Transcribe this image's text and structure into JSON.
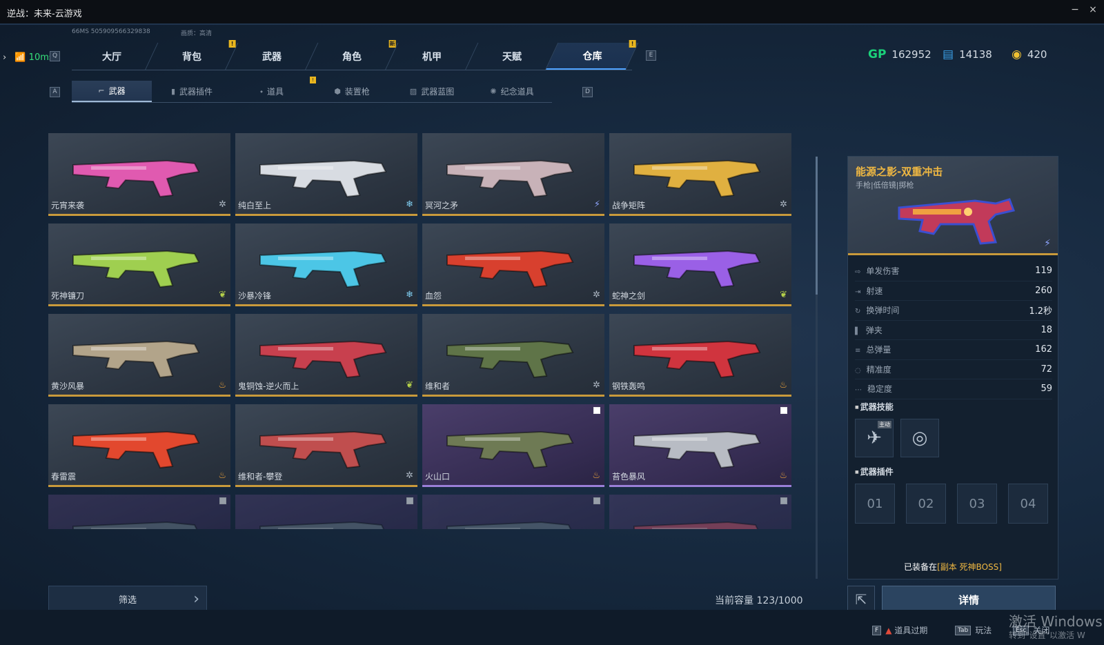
{
  "window": {
    "title": "逆战：未来-云游戏",
    "minimize": "−",
    "close": "×"
  },
  "meta": {
    "info": "66MS  505909566329838",
    "quality": "画质：高清"
  },
  "ping": {
    "arrow": "›",
    "value": "10ms"
  },
  "keys": {
    "q": "Q",
    "e": "E",
    "a": "A",
    "d": "D"
  },
  "nav_tabs": [
    {
      "label": "大厅",
      "badge": ""
    },
    {
      "label": "背包",
      "badge": "!"
    },
    {
      "label": "武器",
      "badge": ""
    },
    {
      "label": "角色",
      "badge": "新"
    },
    {
      "label": "机甲",
      "badge": ""
    },
    {
      "label": "天赋",
      "badge": ""
    },
    {
      "label": "仓库",
      "badge": "!",
      "active": true
    }
  ],
  "currency": {
    "gp_icon": "GP",
    "gp": "162952",
    "ticket": "14138",
    "coin": "420"
  },
  "sub_tabs": [
    {
      "label": "武器",
      "icon": "gun-icon",
      "active": true
    },
    {
      "label": "武器插件",
      "icon": "plugin-icon"
    },
    {
      "label": "道具",
      "icon": "item-icon",
      "badge": "!"
    },
    {
      "label": "装置枪",
      "icon": "device-gun-icon"
    },
    {
      "label": "武器蓝图",
      "icon": "blueprint-icon"
    },
    {
      "label": "纪念道具",
      "icon": "memorial-icon"
    }
  ],
  "weapons": [
    {
      "name": "元宵来袭",
      "tag": "gear",
      "color": "#e05ab0"
    },
    {
      "name": "纯白至上",
      "tag": "snow",
      "color": "#d8dce2"
    },
    {
      "name": "冥河之矛",
      "tag": "bolt",
      "color": "#c8b2b8"
    },
    {
      "name": "战争矩阵",
      "tag": "gear",
      "color": "#e0b040"
    },
    {
      "name": "死神镰刀",
      "tag": "leaf",
      "color": "#9fcf50"
    },
    {
      "name": "沙暴冷锋",
      "tag": "snow",
      "color": "#4cc6e6"
    },
    {
      "name": "血怨",
      "tag": "gear",
      "color": "#d8402e"
    },
    {
      "name": "蛇神之剑",
      "tag": "leaf",
      "color": "#9a60e6"
    },
    {
      "name": "黄沙风暴",
      "tag": "fire",
      "color": "#b2a48a"
    },
    {
      "name": "鬼铜蚀-逆火而上",
      "tag": "leaf",
      "color": "#c8404e"
    },
    {
      "name": "维和者",
      "tag": "gear",
      "color": "#5f7448"
    },
    {
      "name": "钢铁轰鸣",
      "tag": "fire",
      "color": "#d0343e"
    },
    {
      "name": "春雷震",
      "tag": "fire",
      "color": "#e2482e"
    },
    {
      "name": "维和者-攀登",
      "tag": "gear",
      "color": "#c04e4e"
    },
    {
      "name": "火山口",
      "tag": "fire",
      "color": "#6e7a54",
      "purple": true
    },
    {
      "name": "苔色暴风",
      "tag": "fire",
      "color": "#b8bcc4",
      "purple": true
    },
    {
      "name": "",
      "tag": "",
      "color": "#6b7888",
      "purple": true,
      "faded": true
    },
    {
      "name": "",
      "tag": "",
      "color": "#6b7888",
      "purple": true,
      "faded": true
    },
    {
      "name": "",
      "tag": "",
      "color": "#6b7888",
      "purple": true,
      "faded": true
    },
    {
      "name": "",
      "tag": "",
      "color": "#c0506a",
      "purple": true,
      "faded": true
    }
  ],
  "filter": {
    "label": "筛选",
    "chevron": "›"
  },
  "capacity": "当前容量 123/1000",
  "detail": {
    "title": "能源之影-双重冲击",
    "subtitle": "手枪|低倍镜|掷枪",
    "stats": [
      {
        "label": "单发伤害",
        "value": "119"
      },
      {
        "label": "射速",
        "value": "260"
      },
      {
        "label": "换弹时间",
        "value": "1.2秒"
      },
      {
        "label": "弹夹",
        "value": "18"
      },
      {
        "label": "总弹量",
        "value": "162"
      },
      {
        "label": "精准度",
        "value": "72"
      },
      {
        "label": "稳定度",
        "value": "59"
      }
    ],
    "skills_title": "武器技能",
    "skill_tag": "主动",
    "plugins_title": "武器插件",
    "slots": [
      "01",
      "02",
      "03",
      "04"
    ],
    "equipped_prefix": "已装备在",
    "equipped_place": "[副本 死神BOSS]",
    "detail_button": "详情"
  },
  "bottom": {
    "expire_key": "F",
    "expire_label": "道具过期",
    "play_key": "Tab",
    "play_label": "玩法",
    "close_key": "Esc",
    "close_label": "关闭"
  },
  "activation": {
    "line1": "激活 Windows",
    "line2": "转到\"设置\"以激活 W"
  }
}
